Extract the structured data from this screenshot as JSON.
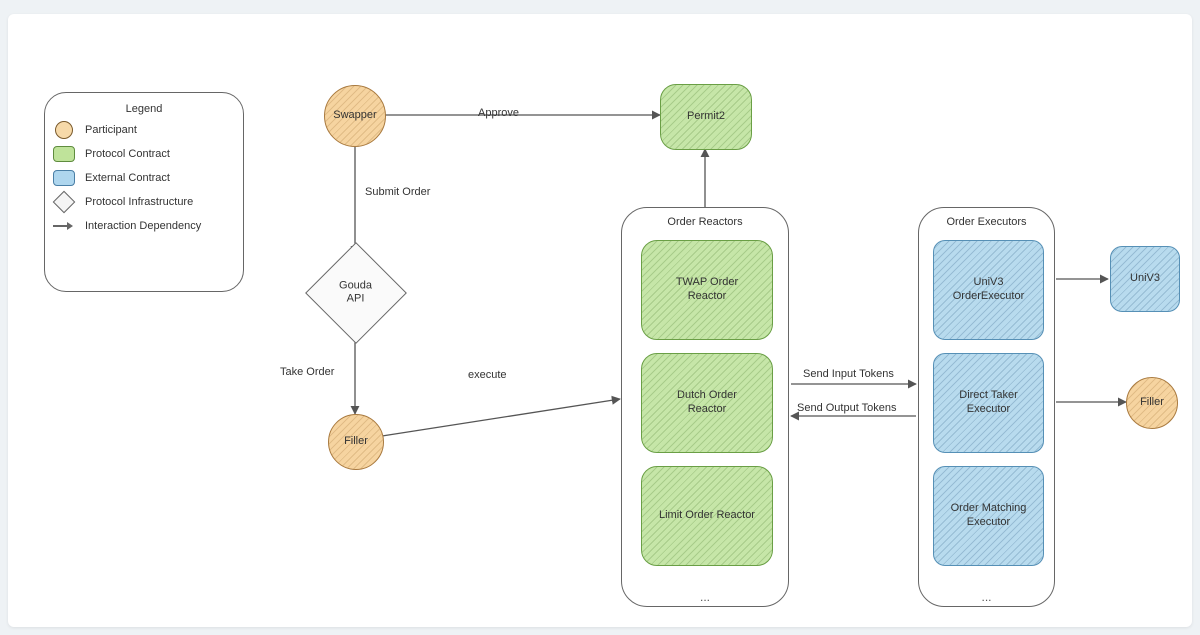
{
  "legend": {
    "title": "Legend",
    "participant": "Participant",
    "protocol_contract": "Protocol Contract",
    "external_contract": "External Contract",
    "protocol_infra": "Protocol Infrastructure",
    "interaction_dep": "Interaction Dependency"
  },
  "nodes": {
    "swapper": "Swapper",
    "gouda_api_l1": "Gouda",
    "gouda_api_l2": "API",
    "filler_main": "Filler",
    "permit2": "Permit2",
    "twap_reactor_l1": "TWAP Order",
    "twap_reactor_l2": "Reactor",
    "dutch_reactor_l1": "Dutch Order",
    "dutch_reactor_l2": "Reactor",
    "limit_reactor": "Limit Order Reactor",
    "univ3_exec_l1": "UniV3",
    "univ3_exec_l2": "OrderExecutor",
    "direct_taker_l1": "Direct Taker",
    "direct_taker_l2": "Executor",
    "order_match_l1": "Order Matching",
    "order_match_l2": "Executor",
    "univ3": "UniV3",
    "filler_right": "Filler"
  },
  "groups": {
    "reactors": "Order Reactors",
    "executors": "Order Executors",
    "ellipsis": "..."
  },
  "edges": {
    "approve": "Approve",
    "submit_order": "Submit Order",
    "take_order": "Take Order",
    "execute": "execute",
    "send_input": "Send Input Tokens",
    "send_output": "Send Output Tokens"
  }
}
